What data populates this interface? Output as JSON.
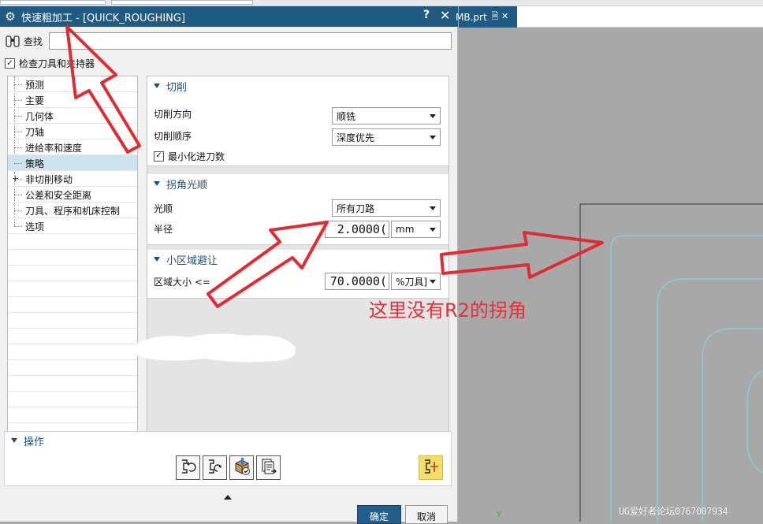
{
  "dialog": {
    "title": "快速粗加工 - [QUICK_ROUGHING]",
    "help_icon": "?",
    "close_icon": "✕",
    "find_label": "查找",
    "find_value": "",
    "check_tool_label": "检查刀具和夹持器",
    "check_tool_checked": true
  },
  "tree": {
    "items": [
      {
        "label": "预测",
        "selected": false
      },
      {
        "label": "主要",
        "selected": false
      },
      {
        "label": "几何体",
        "selected": false
      },
      {
        "label": "刀轴",
        "selected": false
      },
      {
        "label": "进给率和速度",
        "selected": false
      },
      {
        "label": "策略",
        "selected": true
      },
      {
        "label": "非切削移动",
        "selected": false,
        "expander": "+"
      },
      {
        "label": "公差和安全距离",
        "selected": false
      },
      {
        "label": "刀具、程序和机床控制",
        "selected": false
      },
      {
        "label": "选项",
        "selected": false
      }
    ]
  },
  "groups": {
    "cut": {
      "title": "切削",
      "direction_label": "切削方向",
      "direction_value": "顺铣",
      "order_label": "切削顺序",
      "order_value": "深度优先",
      "minimize_label": "最小化进刀数",
      "minimize_checked": true
    },
    "corner": {
      "title": "拐角光顺",
      "smooth_label": "光顺",
      "smooth_value": "所有刀路",
      "radius_label": "半径",
      "radius_value": "2.0000(",
      "radius_unit": "mm"
    },
    "small_area": {
      "title": "小区域避让",
      "size_label": "区域大小 <=",
      "size_value": "70.0000(",
      "size_unit": "%刀具]"
    }
  },
  "actions": {
    "title": "操作",
    "buttons": [
      "generate-icon",
      "replay-icon",
      "verify-icon",
      "list-icon",
      "display-options-icon"
    ]
  },
  "footer": {
    "ok_label": "确定",
    "cancel_label": "取消"
  },
  "viewport": {
    "tab_label": "MB.prt",
    "tab_icons": "🗎 ✕",
    "axis_label": "Y"
  },
  "annotation": {
    "text": "这里没有R2的拐角",
    "color": "#e03038"
  },
  "watermark": "UG爱好者论坛0767007934",
  "colors": {
    "titlebar": "#205b84",
    "selection": "#cde4ee",
    "annotation": "#e03038",
    "geometry": "#7fd6e6"
  }
}
